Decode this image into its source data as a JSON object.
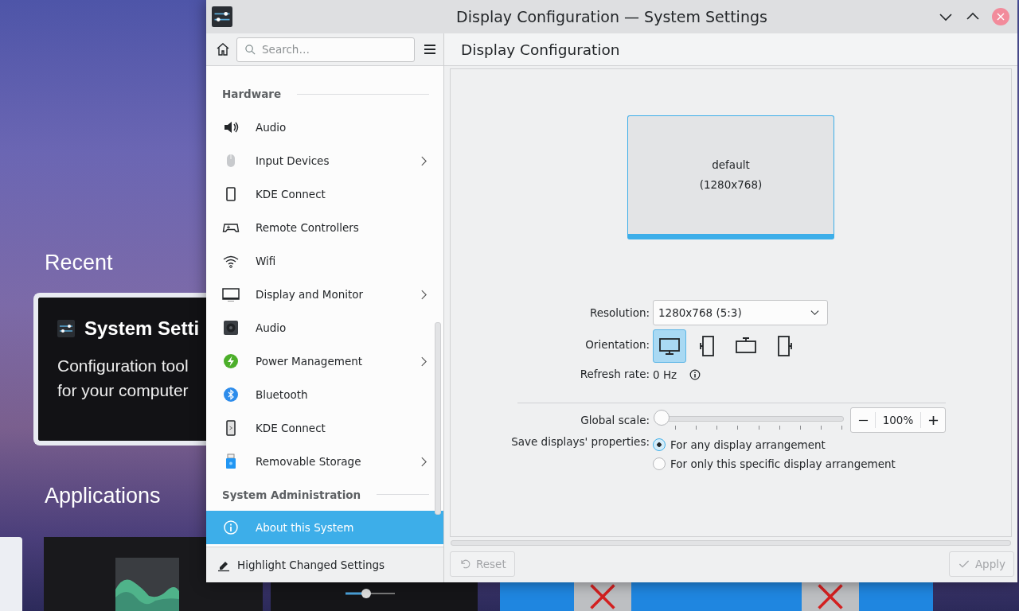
{
  "desktop": {
    "recent_heading": "Recent",
    "recent_card": {
      "title": "System Setti",
      "description": [
        "Configuration tool",
        "for your computer"
      ]
    },
    "applications_heading": "Applications"
  },
  "window": {
    "title": "Display Configuration — System Settings"
  },
  "sidebar": {
    "search": {
      "placeholder": "Search…"
    },
    "sections": [
      {
        "heading": "Hardware",
        "items": [
          {
            "label": "Audio",
            "expandable": false,
            "selected": false
          },
          {
            "label": "Input Devices",
            "expandable": true,
            "selected": false
          },
          {
            "label": "KDE Connect",
            "expandable": false,
            "selected": false
          },
          {
            "label": "Remote Controllers",
            "expandable": false,
            "selected": false
          },
          {
            "label": "Wifi",
            "expandable": false,
            "selected": false
          },
          {
            "label": "Display and Monitor",
            "expandable": true,
            "selected": false
          },
          {
            "label": "Audio",
            "expandable": false,
            "selected": false
          },
          {
            "label": "Power Management",
            "expandable": true,
            "selected": false
          },
          {
            "label": "Bluetooth",
            "expandable": false,
            "selected": false
          },
          {
            "label": "KDE Connect",
            "expandable": false,
            "selected": false
          },
          {
            "label": "Removable Storage",
            "expandable": true,
            "selected": false
          }
        ]
      },
      {
        "heading": "System Administration",
        "items": [
          {
            "label": "About this System",
            "expandable": false,
            "selected": true
          }
        ]
      }
    ],
    "footer_button": "Highlight Changed Settings"
  },
  "page": {
    "title": "Display Configuration",
    "display_preview": {
      "name": "default",
      "resolution": "(1280x768)"
    },
    "form": {
      "resolution": {
        "label": "Resolution:",
        "value": "1280x768 (5:3)"
      },
      "orientation": {
        "label": "Orientation:",
        "options": [
          {
            "selected": true
          },
          {
            "selected": false
          },
          {
            "selected": false
          },
          {
            "selected": false
          }
        ]
      },
      "refresh_rate": {
        "label": "Refresh rate:",
        "value": "0 Hz"
      },
      "global_scale": {
        "label": "Global scale:",
        "level": 0,
        "value": "100%"
      },
      "save_properties": {
        "label": "Save displays' properties:",
        "options": [
          {
            "label": "For any display arrangement",
            "selected": true
          },
          {
            "label": "For only this specific display arrangement",
            "selected": false
          }
        ]
      }
    }
  },
  "footer": {
    "buttons": [
      {
        "label": "Reset",
        "disabled": true
      },
      {
        "label": "Apply",
        "disabled": true
      }
    ]
  }
}
